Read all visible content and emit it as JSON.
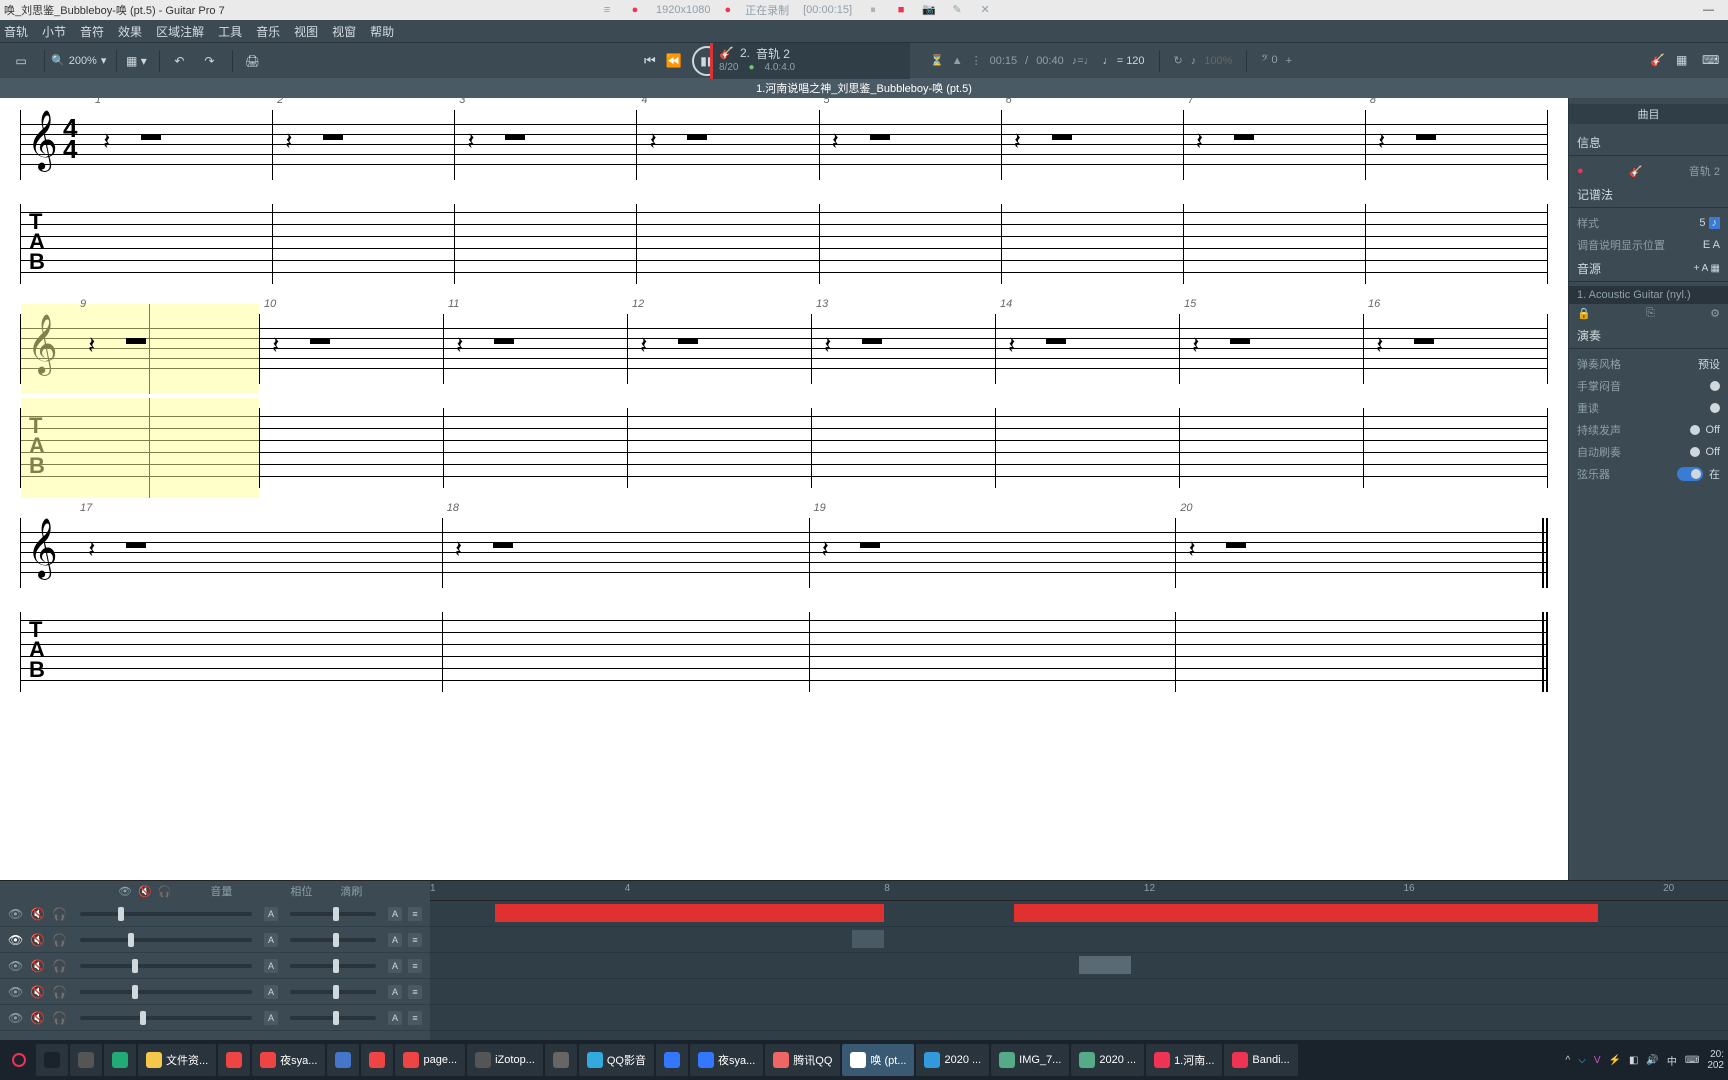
{
  "window": {
    "title": "唤_刘思鉴_Bubbleboy-唤 (pt.5) - Guitar Pro 7",
    "resolution": "1920x1080",
    "recording_label": "正在录制",
    "recording_time": "[00:00:15]"
  },
  "menu": {
    "items": [
      "音轨",
      "小节",
      "音符",
      "效果",
      "区域注解",
      "工具",
      "音乐",
      "视图",
      "视窗",
      "帮助"
    ]
  },
  "toolbar": {
    "zoom": "200%",
    "pct_label": "100%"
  },
  "transport": {
    "track_num": "2.",
    "track_name": "音轨 2",
    "bar_pos": "8/20",
    "beat_pos": "4.0:4.0",
    "time_cur": "00:15",
    "time_total": "00:40",
    "tempo_label": "♩ = 120"
  },
  "document": {
    "title": "1.河南说唱之神_刘思鉴_Bubbleboy-唤 (pt.5)"
  },
  "score": {
    "systems": [
      {
        "start": 1,
        "bars": 8,
        "show_clef": true,
        "show_timesig": true,
        "highlight_bar": null
      },
      {
        "start": 9,
        "bars": 8,
        "show_clef": true,
        "show_timesig": false,
        "highlight_bar": 0
      },
      {
        "start": 17,
        "bars": 4,
        "show_clef": true,
        "show_timesig": false,
        "highlight_bar": null,
        "final": true
      }
    ],
    "timesig_top": "4",
    "timesig_bot": "4",
    "tab_letters": [
      "T",
      "A",
      "B"
    ]
  },
  "side": {
    "tab_label": "曲目",
    "info_header": "信息",
    "track_label": "音轨 2",
    "notation_header": "记谱法",
    "style_label": "样式",
    "style_val": "5",
    "tuning_label": "调音说明显示位置",
    "tuning_val": "E A",
    "sound_header": "音源",
    "instrument": "1. Acoustic Guitar (nyl.)",
    "perf_header": "演奏",
    "rows": [
      {
        "label": "弹奏风格",
        "val": "预设",
        "type": "text"
      },
      {
        "label": "手掌闷音",
        "type": "dot"
      },
      {
        "label": "重读",
        "type": "dot"
      },
      {
        "label": "持续发声",
        "val": "Off",
        "type": "dot"
      },
      {
        "label": "自动刷奏",
        "val": "Off",
        "type": "dot"
      },
      {
        "label": "弦乐器",
        "val": "在",
        "type": "toggle_on"
      }
    ]
  },
  "bottom": {
    "vol_label": "音量",
    "pan_label": "相位",
    "aut_label": "滴刷",
    "ruler_marks": [
      1,
      4,
      8,
      12,
      16,
      20
    ],
    "tracks": [
      {
        "active": false,
        "vol": 0.22,
        "clips": [
          {
            "s": 2,
            "e": 8,
            "c": "red"
          },
          {
            "s": 10,
            "e": 19,
            "c": "red"
          }
        ]
      },
      {
        "active": true,
        "vol": 0.28,
        "clips": [
          {
            "s": 7.5,
            "e": 8,
            "c": "dark"
          }
        ]
      },
      {
        "active": false,
        "vol": 0.3,
        "clips": [
          {
            "s": 11,
            "e": 11.8,
            "c": "grey"
          }
        ]
      },
      {
        "active": false,
        "vol": 0.3,
        "clips": []
      },
      {
        "active": false,
        "vol": 0.35,
        "clips": []
      }
    ]
  },
  "taskbar": {
    "items": [
      {
        "label": "",
        "color": "#1a232b"
      },
      {
        "label": "",
        "color": "#555"
      },
      {
        "label": "",
        "color": "#2a7"
      },
      {
        "label": "文件资...",
        "color": "#f5c84b"
      },
      {
        "label": "",
        "color": "#e44"
      },
      {
        "label": "夜sya...",
        "color": "#e44"
      },
      {
        "label": "",
        "color": "#47c"
      },
      {
        "label": "",
        "color": "#e44"
      },
      {
        "label": "page...",
        "color": "#e44"
      },
      {
        "label": "iZotop...",
        "color": "#555"
      },
      {
        "label": "",
        "color": "#666"
      },
      {
        "label": "QQ影音",
        "color": "#3ad"
      },
      {
        "label": "",
        "color": "#37f"
      },
      {
        "label": "夜sya...",
        "color": "#37f"
      },
      {
        "label": "腾讯QQ",
        "color": "#e66"
      },
      {
        "label": "唤 (pt...",
        "color": "#fff"
      },
      {
        "label": "2020 ...",
        "color": "#39d"
      },
      {
        "label": "IMG_7...",
        "color": "#5a8"
      },
      {
        "label": "2020 ...",
        "color": "#5a8"
      },
      {
        "label": "1.河南...",
        "color": "#e35"
      },
      {
        "label": "Bandi...",
        "color": "#e35"
      }
    ],
    "tray_text": "中",
    "time1": "20:",
    "time2": "202"
  }
}
